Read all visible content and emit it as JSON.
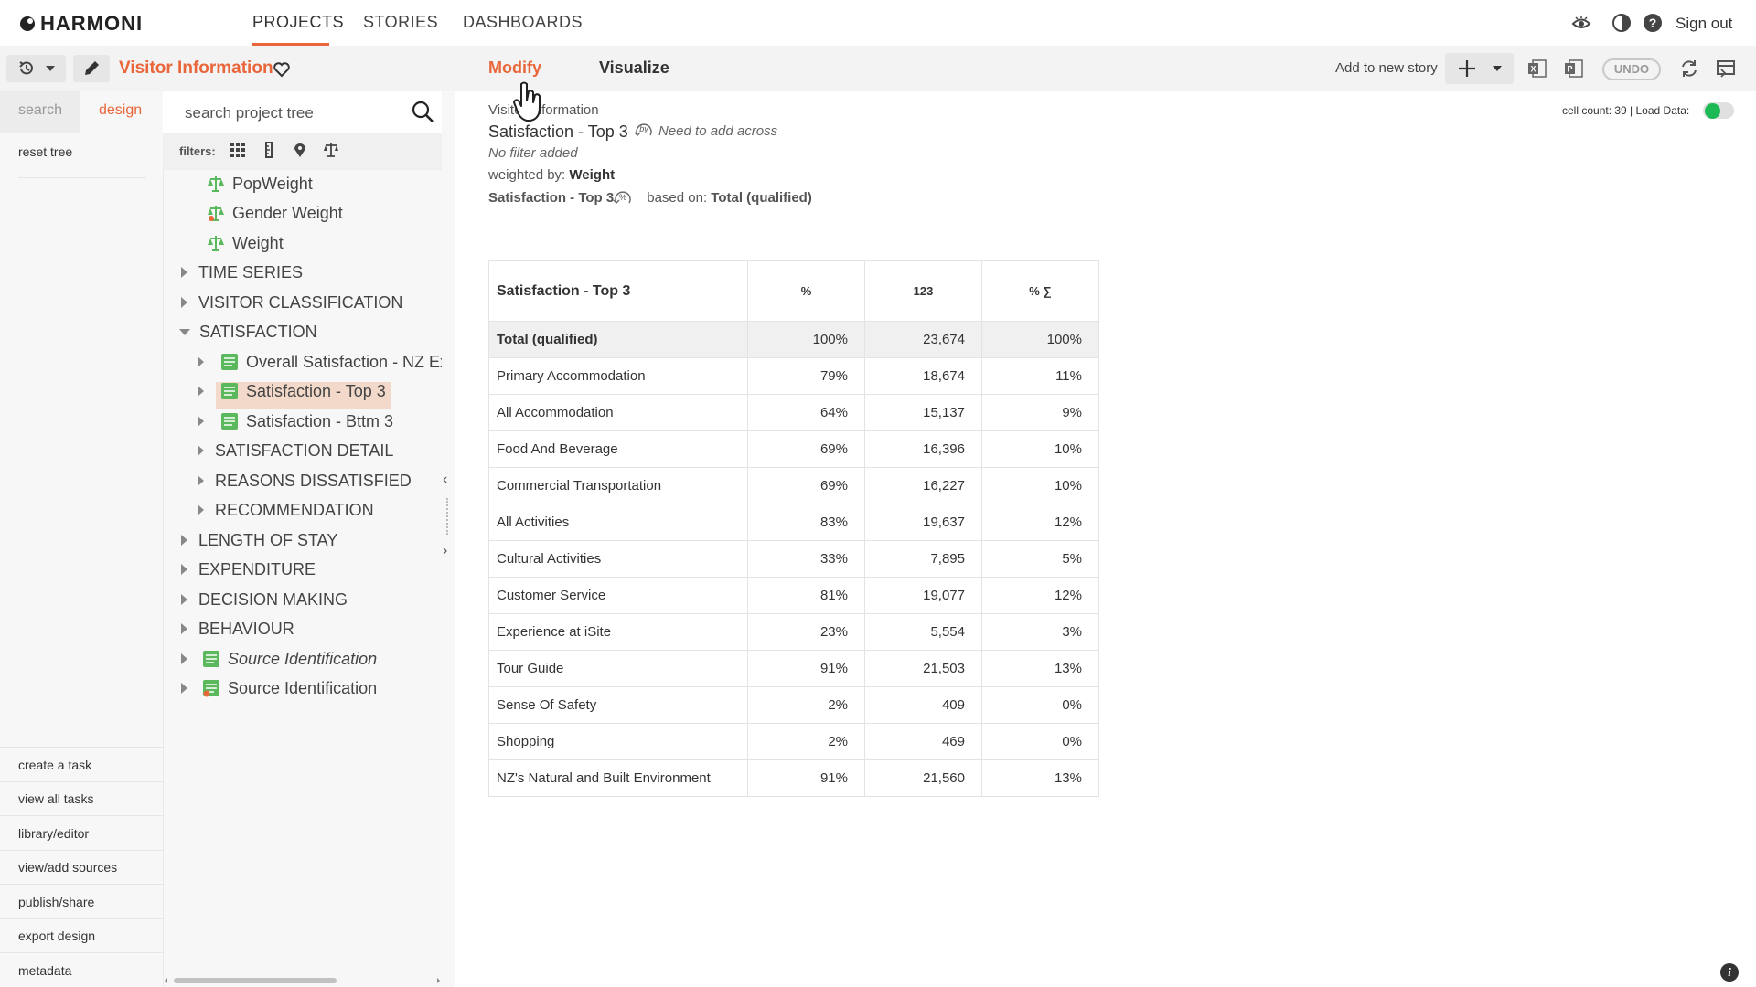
{
  "app": {
    "logo_text": "HARMONI",
    "nav": [
      "PROJECTS",
      "STORIES",
      "DASHBOARDS"
    ],
    "sign_out": "Sign out"
  },
  "project": {
    "name": "Visitor Information"
  },
  "left_tabs": {
    "search": "search",
    "design": "design"
  },
  "reset_tree": "reset tree",
  "left_links": [
    "create a task",
    "view all tasks",
    "library/editor",
    "view/add sources",
    "publish/share",
    "export design",
    "metadata"
  ],
  "tree_search": {
    "placeholder": "search project tree"
  },
  "filters_label": "filters:",
  "tree": [
    {
      "label": "PopWeight",
      "level": 1,
      "icon": "scale-icon",
      "expandable": false
    },
    {
      "label": "Gender Weight",
      "level": 1,
      "icon": "scale-icon-alt",
      "expandable": false
    },
    {
      "label": "Weight",
      "level": 1,
      "icon": "scale-icon",
      "expandable": false
    },
    {
      "label": "TIME SERIES",
      "level": 0,
      "icon": "",
      "expandable": true
    },
    {
      "label": "VISITOR CLASSIFICATION",
      "level": 0,
      "icon": "",
      "expandable": true
    },
    {
      "label": "SATISFACTION",
      "level": 0,
      "icon": "",
      "expandable": true,
      "expanded": true
    },
    {
      "label": "Overall Satisfaction - NZ Ex",
      "level": 2,
      "icon": "list-icon",
      "expandable": true
    },
    {
      "label": "Satisfaction - Top 3",
      "level": 2,
      "icon": "list-icon",
      "expandable": true,
      "selected": true
    },
    {
      "label": "Satisfaction - Bttm 3",
      "level": 2,
      "icon": "list-icon",
      "expandable": true
    },
    {
      "label": "SATISFACTION DETAIL",
      "level": 1,
      "icon": "",
      "expandable": true
    },
    {
      "label": "REASONS DISSATISFIED",
      "level": 1,
      "icon": "",
      "expandable": true
    },
    {
      "label": "RECOMMENDATION",
      "level": 1,
      "icon": "",
      "expandable": true
    },
    {
      "label": "LENGTH OF STAY",
      "level": 0,
      "icon": "",
      "expandable": true
    },
    {
      "label": "EXPENDITURE",
      "level": 0,
      "icon": "",
      "expandable": true
    },
    {
      "label": "DECISION MAKING",
      "level": 0,
      "icon": "",
      "expandable": true
    },
    {
      "label": "BEHAVIOUR",
      "level": 0,
      "icon": "",
      "expandable": true
    },
    {
      "label": "Source Identification",
      "level": 0,
      "icon": "list-icon",
      "expandable": true,
      "italic": true
    },
    {
      "label": "Source Identification",
      "level": 0,
      "icon": "list-icon-alt",
      "expandable": true
    }
  ],
  "main_tabs": {
    "modify": "Modify",
    "visualize": "Visualize"
  },
  "toolbar": {
    "add_to_story": "Add to new story",
    "undo": "UNDO"
  },
  "info": {
    "source": "Visitor Information",
    "title": "Satisfaction - Top 3",
    "across": "Need to add across",
    "filter": "No filter added",
    "weighted_prefix": "weighted by: ",
    "weighted_value": "Weight",
    "based_var": "Satisfaction - Top 3",
    "based_prefix": "based on: ",
    "based_value": "Total (qualified)"
  },
  "status": {
    "cell_count": "cell count: 39 | Load Data:"
  },
  "table": {
    "headers": [
      "Satisfaction - Top 3",
      "%",
      "123",
      "% ∑"
    ],
    "rows": [
      [
        "Total (qualified)",
        "100%",
        "23,674",
        "100%"
      ],
      [
        "Primary Accommodation",
        "79%",
        "18,674",
        "11%"
      ],
      [
        "All Accommodation",
        "64%",
        "15,137",
        "9%"
      ],
      [
        "Food And Beverage",
        "69%",
        "16,396",
        "10%"
      ],
      [
        "Commercial Transportation",
        "69%",
        "16,227",
        "10%"
      ],
      [
        "All Activities",
        "83%",
        "19,637",
        "12%"
      ],
      [
        "Cultural Activities",
        "33%",
        "7,895",
        "5%"
      ],
      [
        "Customer Service",
        "81%",
        "19,077",
        "12%"
      ],
      [
        "Experience at iSite",
        "23%",
        "5,554",
        "3%"
      ],
      [
        "Tour Guide",
        "91%",
        "21,503",
        "13%"
      ],
      [
        "Sense Of Safety",
        "2%",
        "409",
        "0%"
      ],
      [
        "Shopping",
        "2%",
        "469",
        "0%"
      ],
      [
        "NZ's Natural and Built Environment",
        "91%",
        "21,560",
        "13%"
      ]
    ]
  },
  "colors": {
    "accent": "#e8663a",
    "list_green": "#5cb85c",
    "toggle_on": "#1db954"
  }
}
